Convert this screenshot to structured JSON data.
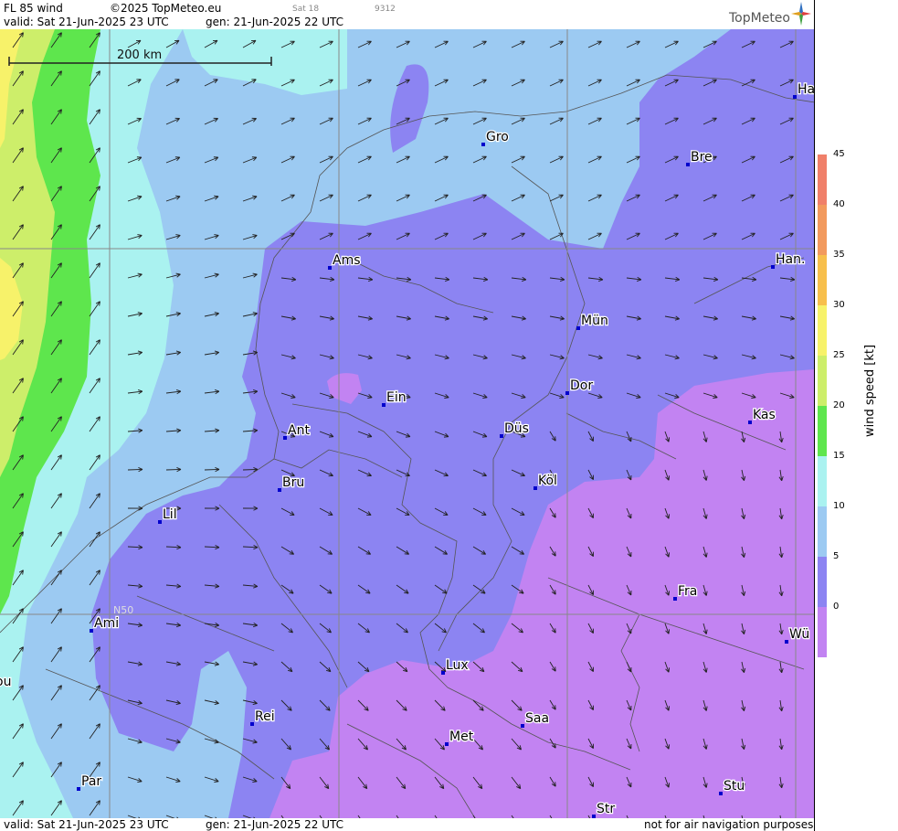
{
  "header": {
    "title": "FL 85 wind",
    "copyright": "©2025 TopMeteo.eu",
    "sat": "Sat 18",
    "code": "9312",
    "valid": "valid:  Sat  21-Jun-2025  23 UTC",
    "gen": "gen: 21-Jun-2025 22 UTC",
    "logo": "TopMeteo"
  },
  "footer": {
    "valid": "valid:  Sat  21-Jun-2025  23 UTC",
    "gen": "gen: 21-Jun-2025 22 UTC",
    "disclaimer": "not for air navigation purposes"
  },
  "scale_bar": {
    "label": "200 km"
  },
  "latitude_label": "N50",
  "colorbar": {
    "title": "wind  speed  [kt]",
    "ticks": [
      "45",
      "40",
      "35",
      "30",
      "25",
      "20",
      "15",
      "10",
      "5",
      "0"
    ],
    "colors": [
      "#f0806a",
      "#f29a5e",
      "#f7bf4c",
      "#f7f26a",
      "#cdee6a",
      "#5ee64d",
      "#aaf2f0",
      "#9ccaf2",
      "#8c84f2",
      "#c283f2"
    ]
  },
  "cities": [
    {
      "name": "Gro"
    },
    {
      "name": "Bre"
    },
    {
      "name": "Ha"
    },
    {
      "name": "Ams"
    },
    {
      "name": "Han."
    },
    {
      "name": "Mün"
    },
    {
      "name": "Ein"
    },
    {
      "name": "Dor"
    },
    {
      "name": "Ant"
    },
    {
      "name": "Kas"
    },
    {
      "name": "Düs"
    },
    {
      "name": "Bru"
    },
    {
      "name": "Köl"
    },
    {
      "name": "Lil"
    },
    {
      "name": "Fra"
    },
    {
      "name": "Ami"
    },
    {
      "name": "Wü"
    },
    {
      "name": "Lux"
    },
    {
      "name": "ou"
    },
    {
      "name": "Rei"
    },
    {
      "name": "Saa"
    },
    {
      "name": "Met"
    },
    {
      "name": "Stu"
    },
    {
      "name": "Par"
    },
    {
      "name": "Str"
    }
  ],
  "colors": {
    "city_marker": "#0000cc",
    "grid": "#888888",
    "border": "#555555"
  }
}
